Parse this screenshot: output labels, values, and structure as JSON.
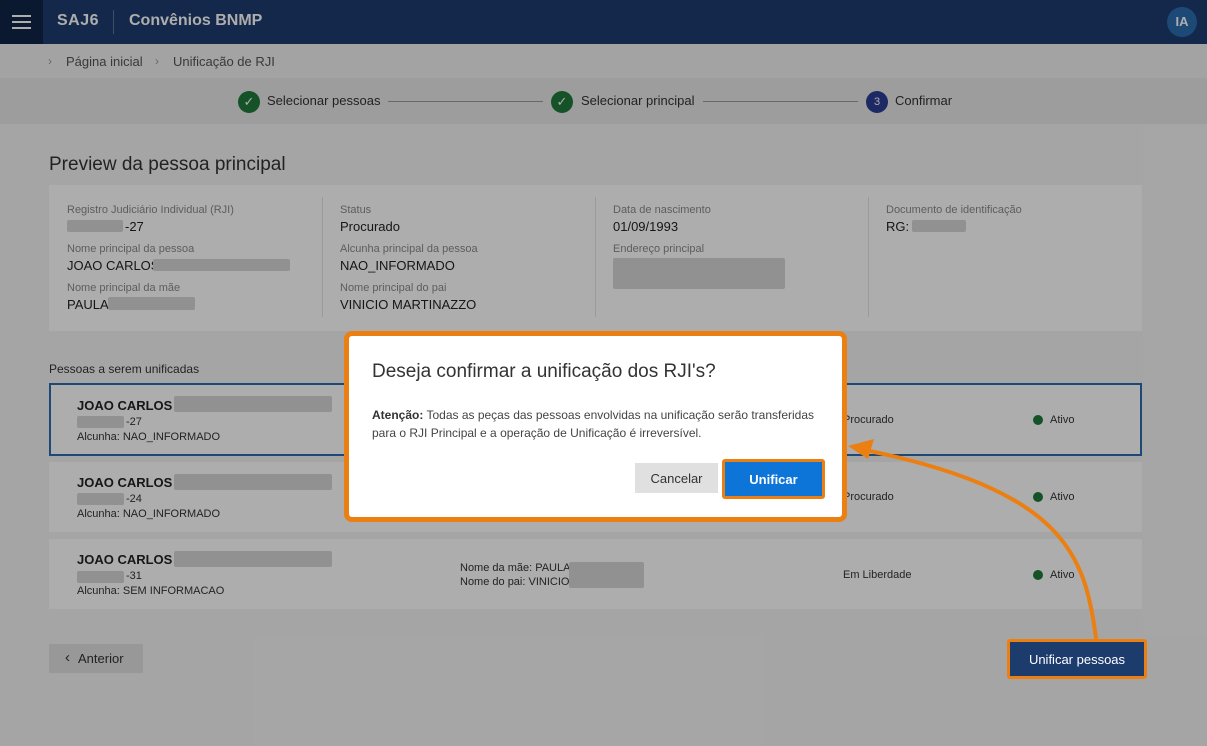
{
  "topbar": {
    "brand": "SAJ6",
    "app_title": "Convênios BNMP",
    "avatar_initials": "IA"
  },
  "breadcrumb": {
    "items": [
      "Página inicial",
      "Unificação de RJI"
    ]
  },
  "stepper": {
    "steps": [
      {
        "label": "Selecionar pessoas",
        "state": "done",
        "icon": "check-icon"
      },
      {
        "label": "Selecionar principal",
        "state": "done",
        "icon": "check-icon"
      },
      {
        "label": "Confirmar",
        "state": "current",
        "number": "3"
      }
    ]
  },
  "preview": {
    "title": "Preview da pessoa principal",
    "rji_label": "Registro Judiciário Individual (RJI)",
    "rji_value": "-27",
    "status_label": "Status",
    "status_value": "Procurado",
    "nascimento_label": "Data de nascimento",
    "nascimento_value": "01/09/1993",
    "documento_label": "Documento de identificação",
    "documento_value": "RG:",
    "nome_label": "Nome principal da pessoa",
    "nome_value": "JOAO CARLOS",
    "alcunha_label": "Alcunha principal da pessoa",
    "alcunha_value": "NAO_INFORMADO",
    "endereco_label": "Endereço principal",
    "mae_label": "Nome principal da mãe",
    "mae_value": "PAULA",
    "pai_label": "Nome principal do pai",
    "pai_value": "VINICIO MARTINAZZO"
  },
  "people": {
    "title": "Pessoas a serem unificadas",
    "items": [
      {
        "name": "JOAO CARLOS",
        "rji": "-27",
        "alcunha": "Alcunha: NAO_INFORMADO",
        "mae": "",
        "pai": "",
        "status": "Procurado",
        "state": "Ativo",
        "selected": true
      },
      {
        "name": "JOAO CARLOS",
        "rji": "-24",
        "alcunha": "Alcunha: NAO_INFORMADO",
        "mae": "",
        "pai": "",
        "status": "Procurado",
        "state": "Ativo",
        "selected": false
      },
      {
        "name": "JOAO CARLOS",
        "rji": "-31",
        "alcunha": "Alcunha: SEM INFORMACAO",
        "mae": "Nome da mãe: PAULA",
        "pai": "Nome do pai: VINICIO",
        "status": "Em Liberdade",
        "state": "Ativo",
        "selected": false
      }
    ]
  },
  "footer": {
    "back_label": "Anterior",
    "submit_label": "Unificar pessoas"
  },
  "modal": {
    "title": "Deseja confirmar a unificação dos RJI's?",
    "warning_label": "Atenção:",
    "warning_text": "Todas as peças das pessoas envolvidas na unificação serão transferidas para o RJI Principal e a operação de Unificação é irreversível.",
    "cancel_label": "Cancelar",
    "confirm_label": "Unificar"
  },
  "colors": {
    "topbar": "#1d3c6e",
    "highlight": "#ec7f11",
    "primary": "#0d75d8",
    "success": "#1f7a3b"
  }
}
